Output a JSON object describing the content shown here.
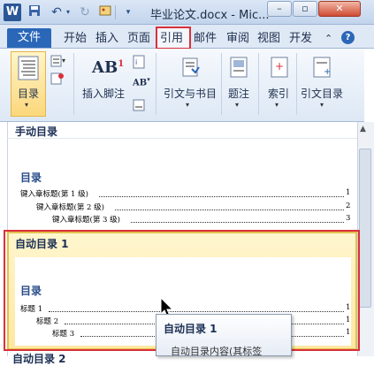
{
  "titlebar": {
    "app_logo": "W",
    "title": "毕业论文.docx - Mic...",
    "icons": [
      "save-icon",
      "undo-icon",
      "redo-icon",
      "picture-icon",
      "customize-icon"
    ],
    "window_buttons": [
      "minimize",
      "restore",
      "close"
    ]
  },
  "tabs": [
    "文件",
    "开始",
    "插入",
    "页面",
    "引用",
    "邮件",
    "审阅",
    "视图",
    "开发"
  ],
  "ribbon": {
    "toc_label": "目录",
    "footnote_label": "插入脚注",
    "citation_label": "引文与书目",
    "caption_label": "题注",
    "index_label": "索引",
    "toa_label": "引文目录",
    "ab_text": "AB",
    "ab_superscript": "1",
    "ab2_text": "AB"
  },
  "gallery": {
    "manual_heading": "手动目录",
    "manual_toc_title": "目录",
    "manual_lines": [
      {
        "text": "键入章标题(第 1 级)",
        "page": "1"
      },
      {
        "text": "键入章标题(第 2 级)",
        "page": "2"
      },
      {
        "text": "键入章标题(第 3 级)",
        "page": "3"
      }
    ],
    "auto1_heading": "自动目录 1",
    "auto1_toc_title": "目录",
    "auto1_lines": [
      {
        "text": "标题 1",
        "page": "1"
      },
      {
        "text": "标题 2",
        "page": "1"
      },
      {
        "text": "标题 3",
        "page": "1"
      }
    ],
    "auto2_heading": "自动目录 2"
  },
  "tooltip": {
    "title": "自动目录 1",
    "body": "自动目录内容(其标签"
  },
  "colors": {
    "accent_red": "#d9303a",
    "file_tab": "#2a67b8",
    "selected_gold": "#e5c04d"
  }
}
